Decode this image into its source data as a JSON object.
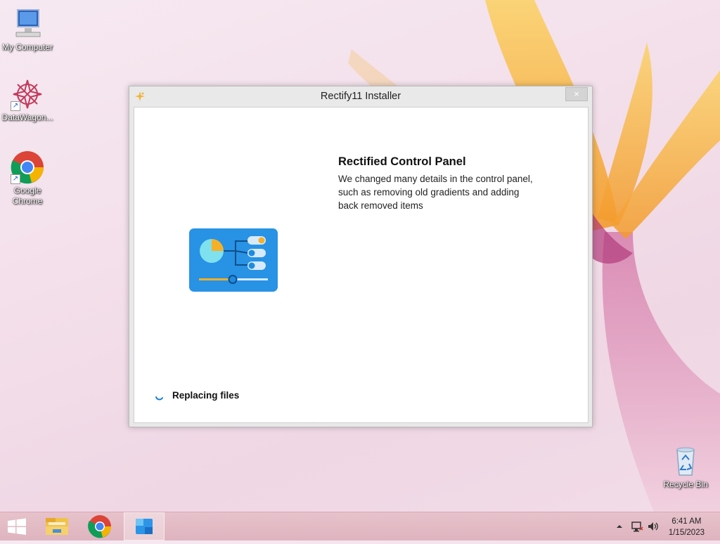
{
  "desktop": {
    "icons": [
      {
        "label": "My Computer"
      },
      {
        "label": "DataWagon..."
      },
      {
        "label": "Google Chrome"
      },
      {
        "label": "Recycle Bin"
      }
    ]
  },
  "window": {
    "title": "Rectify11 Installer",
    "close_label": "×",
    "heading": "Rectified Control Panel",
    "description": "We changed many details in the control panel, such as removing old gradients and adding back removed items",
    "status": "Replacing files"
  },
  "taskbar": {
    "time": "6:41 AM",
    "date": "1/15/2023"
  },
  "colors": {
    "accent_blue": "#1f8be0",
    "slider_yellow": "#f5b027",
    "pie_cyan": "#7fe0ee"
  }
}
